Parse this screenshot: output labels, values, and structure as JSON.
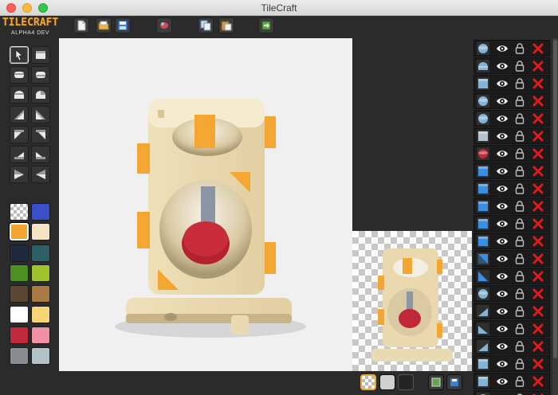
{
  "window": {
    "title": "TileCraft"
  },
  "logo": {
    "title": "TILECRAFT",
    "subtitle": "ALPHA4 DEV"
  },
  "toolbar": {
    "buttons": [
      {
        "name": "new-file-button",
        "icon": "new-document-icon"
      },
      {
        "name": "open-file-button",
        "icon": "folder-icon"
      },
      {
        "name": "save-file-button",
        "icon": "floppy-icon"
      },
      {
        "name": "render-button",
        "icon": "render-icon"
      },
      {
        "name": "copy-button",
        "icon": "copy-icon"
      },
      {
        "name": "paste-button",
        "icon": "paste-icon"
      },
      {
        "name": "export-button",
        "icon": "export-icon"
      }
    ]
  },
  "tools": [
    {
      "name": "select",
      "icon": "pointer-icon",
      "active": true
    },
    {
      "name": "box",
      "icon": "box-icon"
    },
    {
      "name": "cylinder-h",
      "icon": "cylinder-horizontal-icon"
    },
    {
      "name": "cylinder-v",
      "icon": "cylinder-vertical-icon"
    },
    {
      "name": "half-cylinder-a",
      "icon": "half-cylinder-icon"
    },
    {
      "name": "half-cylinder-b",
      "icon": "half-cylinder-alt-icon"
    },
    {
      "name": "wedge-a",
      "icon": "wedge-up-left-icon"
    },
    {
      "name": "wedge-b",
      "icon": "wedge-up-right-icon"
    },
    {
      "name": "wedge-c",
      "icon": "wedge-down-left-icon"
    },
    {
      "name": "wedge-d",
      "icon": "wedge-down-right-icon"
    },
    {
      "name": "ramp-a",
      "icon": "ramp-left-icon"
    },
    {
      "name": "ramp-b",
      "icon": "ramp-right-icon"
    },
    {
      "name": "corner-a",
      "icon": "corner-left-icon"
    },
    {
      "name": "corner-b",
      "icon": "corner-right-icon"
    }
  ],
  "palette": {
    "selected_index": 2,
    "colors": [
      "transparent",
      "#3a4fc8",
      "#f5a432",
      "#f3e4c4",
      "#1f2a3c",
      "#2f5f66",
      "#4e8f21",
      "#9fc42b",
      "#5a4633",
      "#a97a43",
      "#ffffff",
      "#f5d574",
      "#c02a3c",
      "#ee90a6",
      "#8a8d90",
      "#b3c1c9"
    ]
  },
  "preview_controls": [
    {
      "name": "bg-checker-button",
      "color": "#ffffff",
      "selected": true
    },
    {
      "name": "bg-light-button",
      "color": "#cfcfcf"
    },
    {
      "name": "bg-dark-button",
      "color": "#242424"
    },
    {
      "name": "export-png-button",
      "color": "#3c3c3c"
    },
    {
      "name": "save-preview-button",
      "color": "#3c3c3c"
    }
  ],
  "layers": [
    {
      "shape": "sphere",
      "color": "#85b3d4"
    },
    {
      "shape": "half-round",
      "color": "#85b3d4"
    },
    {
      "shape": "box",
      "color": "#85b3d4"
    },
    {
      "shape": "sphere",
      "color": "#85b3d4"
    },
    {
      "shape": "sphere",
      "color": "#85b3d4"
    },
    {
      "shape": "box",
      "color": "#b8c4cc"
    },
    {
      "shape": "sphere",
      "color": "#c02a3c"
    },
    {
      "shape": "box",
      "color": "#3a8fe0"
    },
    {
      "shape": "box",
      "color": "#3a8fe0"
    },
    {
      "shape": "box",
      "color": "#3a8fe0"
    },
    {
      "shape": "box",
      "color": "#3a8fe0"
    },
    {
      "shape": "box",
      "color": "#3a8fe0"
    },
    {
      "shape": "wedge",
      "color": "#3a8fe0"
    },
    {
      "shape": "wedge-alt",
      "color": "#3a8fe0"
    },
    {
      "shape": "sphere",
      "color": "#85b3d4"
    },
    {
      "shape": "ramp",
      "color": "#85b3d4"
    },
    {
      "shape": "ramp-alt",
      "color": "#85b3d4"
    },
    {
      "shape": "ramp",
      "color": "#85b3d4"
    },
    {
      "shape": "box",
      "color": "#85b3d4"
    },
    {
      "shape": "box",
      "color": "#85b3d4"
    },
    {
      "shape": "sphere",
      "color": "#85b3d4"
    }
  ],
  "icons": {
    "visibility": "eye-icon",
    "lock": "padlock-icon",
    "delete": "red-x-icon"
  }
}
